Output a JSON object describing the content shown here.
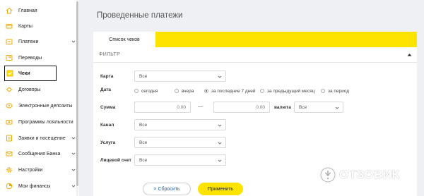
{
  "sidebar": {
    "items": [
      {
        "label": "Главная",
        "icon": "home-icon"
      },
      {
        "label": "Карты",
        "icon": "card-icon"
      },
      {
        "label": "Платежи",
        "icon": "payments-icon",
        "expandable": true
      },
      {
        "label": "Переводы",
        "icon": "transfer-icon"
      },
      {
        "label": "Чеки",
        "icon": "receipt-icon",
        "active": true
      },
      {
        "label": "Договоры",
        "icon": "contract-icon"
      },
      {
        "label": "Электронные депозиты",
        "icon": "deposit-icon"
      },
      {
        "label": "Программы лояльности",
        "icon": "loyalty-icon"
      },
      {
        "label": "Заявки и посещение",
        "icon": "requests-icon",
        "expandable": true
      },
      {
        "label": "Сообщения Банка",
        "icon": "messages-icon",
        "expandable": true
      },
      {
        "label": "Настройки",
        "icon": "settings-icon",
        "expandable": true
      },
      {
        "label": "Мои финансы",
        "icon": "finance-icon",
        "expandable": true
      }
    ]
  },
  "main": {
    "title": "Проведенные платежи",
    "tab_label": "Список чеков",
    "filter_title": "ФИЛЬТР",
    "fields": {
      "card_label": "Карта",
      "card_value": "Все",
      "date_label": "Дата",
      "date_options": [
        "сегодня",
        "вчера",
        "за последние 7 дней",
        "за предыдущий месяц",
        "за период"
      ],
      "date_selected": "за последние 7 дней",
      "sum_label": "Сумма",
      "sum_from": "0.00",
      "sum_to": "0.00",
      "sum_dash": "—",
      "currency_label": "валюта",
      "currency_value": "Все",
      "channel_label": "Канал",
      "channel_value": "Все",
      "service_label": "Услуга",
      "service_value": "Все",
      "account_label": "Лицевой счет",
      "account_value": "Все"
    },
    "reset_label": "× Сбросить",
    "apply_label": "Применить"
  },
  "watermark": {
    "text": "ОТЗОВИК"
  },
  "colors": {
    "accent": "#fce300",
    "background": "#eef0f4",
    "link": "#1a5fb4"
  }
}
